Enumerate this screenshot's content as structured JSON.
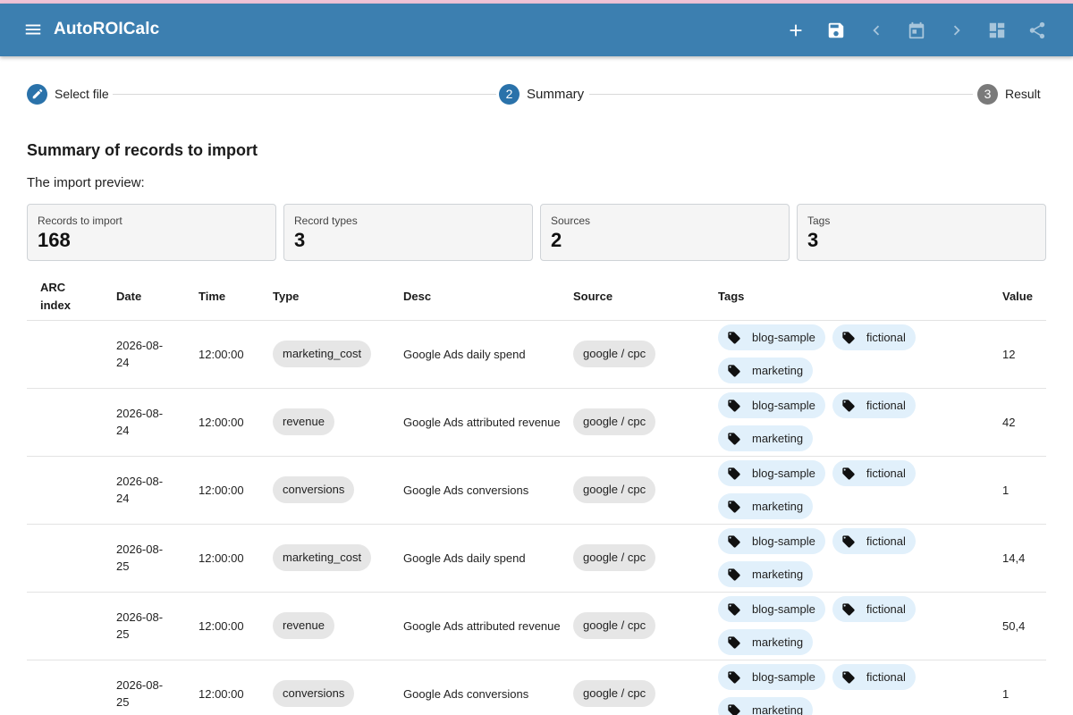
{
  "app": {
    "title": "AutoROICalc",
    "colors": {
      "appbar": "#3c7fb0",
      "step_active": "#2a72aa",
      "step_inactive": "#7a7a7a",
      "tag_chip": "#e1f0fb",
      "chip": "#e6e6e6"
    },
    "toolbar_icons": [
      "plus-icon",
      "save-icon",
      "chevron-left-icon",
      "calendar-icon",
      "chevron-right-icon",
      "dashboard-icon",
      "share-icon"
    ]
  },
  "stepper": {
    "steps": [
      {
        "label": "Select file",
        "marker": "",
        "state": "complete"
      },
      {
        "label": "Summary",
        "marker": "2",
        "state": "active"
      },
      {
        "label": "Result",
        "marker": "3",
        "state": "inactive"
      }
    ]
  },
  "summary": {
    "title": "Summary of records to import",
    "preview_label": "The import preview:",
    "cards": [
      {
        "label": "Records to import",
        "value": "168"
      },
      {
        "label": "Record types",
        "value": "3"
      },
      {
        "label": "Sources",
        "value": "2"
      },
      {
        "label": "Tags",
        "value": "3"
      }
    ]
  },
  "table": {
    "headers": {
      "arc_line1": "ARC",
      "arc_line2": "index",
      "date": "Date",
      "time": "Time",
      "type": "Type",
      "desc": "Desc",
      "source": "Source",
      "tags": "Tags",
      "value": "Value"
    },
    "rows": [
      {
        "arc": "",
        "date_line1": "2026-08-",
        "date_line2": "24",
        "time": "12:00:00",
        "type": "marketing_cost",
        "desc": "Google Ads daily spend",
        "source": "google / cpc",
        "tags": [
          "blog-sample",
          "fictional",
          "marketing"
        ],
        "value": "12"
      },
      {
        "arc": "",
        "date_line1": "2026-08-",
        "date_line2": "24",
        "time": "12:00:00",
        "type": "revenue",
        "desc": "Google Ads attributed revenue",
        "source": "google / cpc",
        "tags": [
          "blog-sample",
          "fictional",
          "marketing"
        ],
        "value": "42"
      },
      {
        "arc": "",
        "date_line1": "2026-08-",
        "date_line2": "24",
        "time": "12:00:00",
        "type": "conversions",
        "desc": "Google Ads conversions",
        "source": "google / cpc",
        "tags": [
          "blog-sample",
          "fictional",
          "marketing"
        ],
        "value": "1"
      },
      {
        "arc": "",
        "date_line1": "2026-08-",
        "date_line2": "25",
        "time": "12:00:00",
        "type": "marketing_cost",
        "desc": "Google Ads daily spend",
        "source": "google / cpc",
        "tags": [
          "blog-sample",
          "fictional",
          "marketing"
        ],
        "value": "14,4"
      },
      {
        "arc": "",
        "date_line1": "2026-08-",
        "date_line2": "25",
        "time": "12:00:00",
        "type": "revenue",
        "desc": "Google Ads attributed revenue",
        "source": "google / cpc",
        "tags": [
          "blog-sample",
          "fictional",
          "marketing"
        ],
        "value": "50,4"
      },
      {
        "arc": "",
        "date_line1": "2026-08-",
        "date_line2": "25",
        "time": "12:00:00",
        "type": "conversions",
        "desc": "Google Ads conversions",
        "source": "google / cpc",
        "tags": [
          "blog-sample",
          "fictional",
          "marketing"
        ],
        "value": "1"
      }
    ]
  }
}
